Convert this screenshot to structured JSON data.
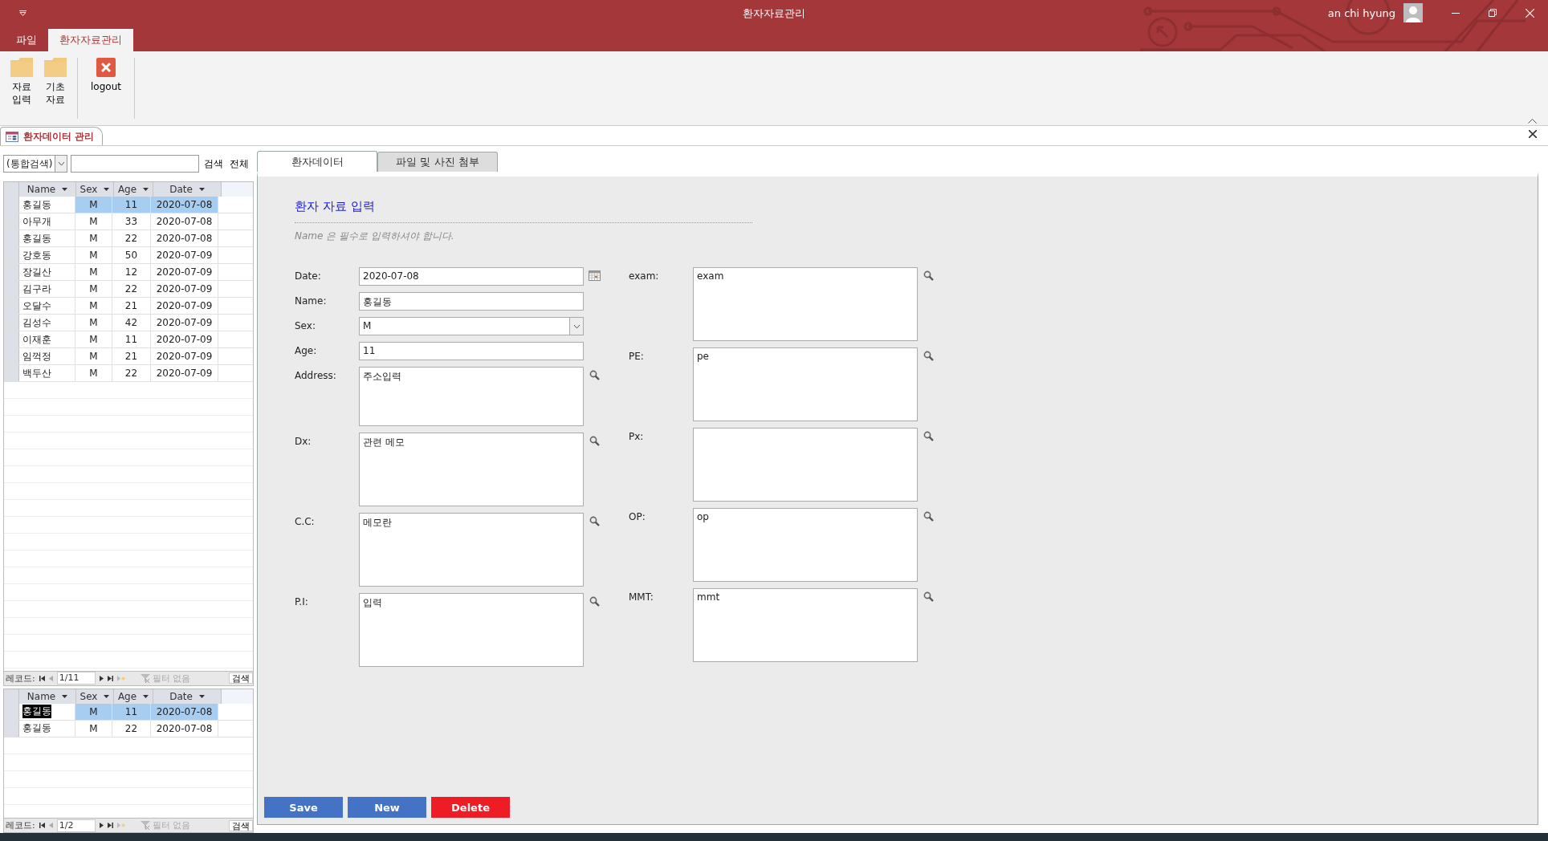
{
  "window": {
    "title": "환자자료관리",
    "user": "an chi hyung"
  },
  "ribbon_tabs": [
    {
      "label": "파일",
      "selected": false
    },
    {
      "label": "환자자료관리",
      "selected": true
    }
  ],
  "ribbon_buttons": [
    {
      "label": "자료\n입력",
      "kind": "folder"
    },
    {
      "label": "기초\n자료",
      "kind": "folder"
    },
    {
      "label": "logout",
      "kind": "logout"
    }
  ],
  "document_tab": {
    "label": "환자데이터 관리"
  },
  "search": {
    "scope": "(통합검색)",
    "search_link": "검색",
    "all_link": "전체"
  },
  "grids": [
    {
      "columns": [
        "Name",
        "Sex",
        "Age",
        "Date"
      ],
      "rows": [
        {
          "name": "홍길동",
          "sex": "M",
          "age": "11",
          "date": "2020-07-08",
          "selected": true,
          "editing": false
        },
        {
          "name": "아무개",
          "sex": "M",
          "age": "33",
          "date": "2020-07-08",
          "selected": false,
          "editing": false
        },
        {
          "name": "홍길동",
          "sex": "M",
          "age": "22",
          "date": "2020-07-08",
          "selected": false,
          "editing": false
        },
        {
          "name": "강호동",
          "sex": "M",
          "age": "50",
          "date": "2020-07-09",
          "selected": false,
          "editing": false
        },
        {
          "name": "장길산",
          "sex": "M",
          "age": "12",
          "date": "2020-07-09",
          "selected": false,
          "editing": false
        },
        {
          "name": "김구라",
          "sex": "M",
          "age": "22",
          "date": "2020-07-09",
          "selected": false,
          "editing": false
        },
        {
          "name": "오달수",
          "sex": "M",
          "age": "21",
          "date": "2020-07-09",
          "selected": false,
          "editing": false
        },
        {
          "name": "김성수",
          "sex": "M",
          "age": "42",
          "date": "2020-07-09",
          "selected": false,
          "editing": false
        },
        {
          "name": "이재훈",
          "sex": "M",
          "age": "11",
          "date": "2020-07-09",
          "selected": false,
          "editing": false
        },
        {
          "name": "임꺽정",
          "sex": "M",
          "age": "21",
          "date": "2020-07-09",
          "selected": false,
          "editing": false
        },
        {
          "name": "백두산",
          "sex": "M",
          "age": "22",
          "date": "2020-07-09",
          "selected": false,
          "editing": false
        }
      ],
      "nav": {
        "label": "레코드:",
        "position": "1/11",
        "filter": "필터 없음",
        "search": "검색"
      }
    },
    {
      "columns": [
        "Name",
        "Sex",
        "Age",
        "Date"
      ],
      "rows": [
        {
          "name": "홍길동",
          "sex": "M",
          "age": "11",
          "date": "2020-07-08",
          "selected": true,
          "editing": true
        },
        {
          "name": "홍길동",
          "sex": "M",
          "age": "22",
          "date": "2020-07-08",
          "selected": false,
          "editing": false
        }
      ],
      "nav": {
        "label": "레코드:",
        "position": "1/2",
        "filter": "필터 없음",
        "search": "검색"
      }
    }
  ],
  "form_tabs": [
    {
      "label": "환자데이터",
      "selected": true
    },
    {
      "label": "파일 및 사진 첨부",
      "selected": false
    }
  ],
  "form": {
    "heading": "환자 자료 입력",
    "hint": "Name 은 필수로 입력하셔야 합니다.",
    "left_fields": [
      {
        "label": "Date:",
        "kind": "date",
        "value": "2020-07-08"
      },
      {
        "label": "Name:",
        "kind": "line",
        "value": "홍길동"
      },
      {
        "label": "Sex:",
        "kind": "select",
        "value": "M"
      },
      {
        "label": "Age:",
        "kind": "line",
        "value": "11"
      },
      {
        "label": "Address:",
        "kind": "area",
        "value": "주소입력"
      },
      {
        "label": "Dx:",
        "kind": "area",
        "value": "관련 메모"
      },
      {
        "label": "C.C:",
        "kind": "area",
        "value": "메모란"
      },
      {
        "label": "P.I:",
        "kind": "area",
        "value": "입력"
      }
    ],
    "right_fields": [
      {
        "label": "exam:",
        "kind": "area",
        "value": "exam"
      },
      {
        "label": "PE:",
        "kind": "area",
        "value": "pe"
      },
      {
        "label": "Px:",
        "kind": "area"
      },
      {
        "label": "OP:",
        "kind": "area",
        "value": "op"
      },
      {
        "label": "MMT:",
        "kind": "area",
        "value": "mmt"
      }
    ]
  },
  "buttons": [
    {
      "label": "Save",
      "kind": "primary"
    },
    {
      "label": "New",
      "kind": "primary"
    },
    {
      "label": "Delete",
      "kind": "danger"
    }
  ]
}
